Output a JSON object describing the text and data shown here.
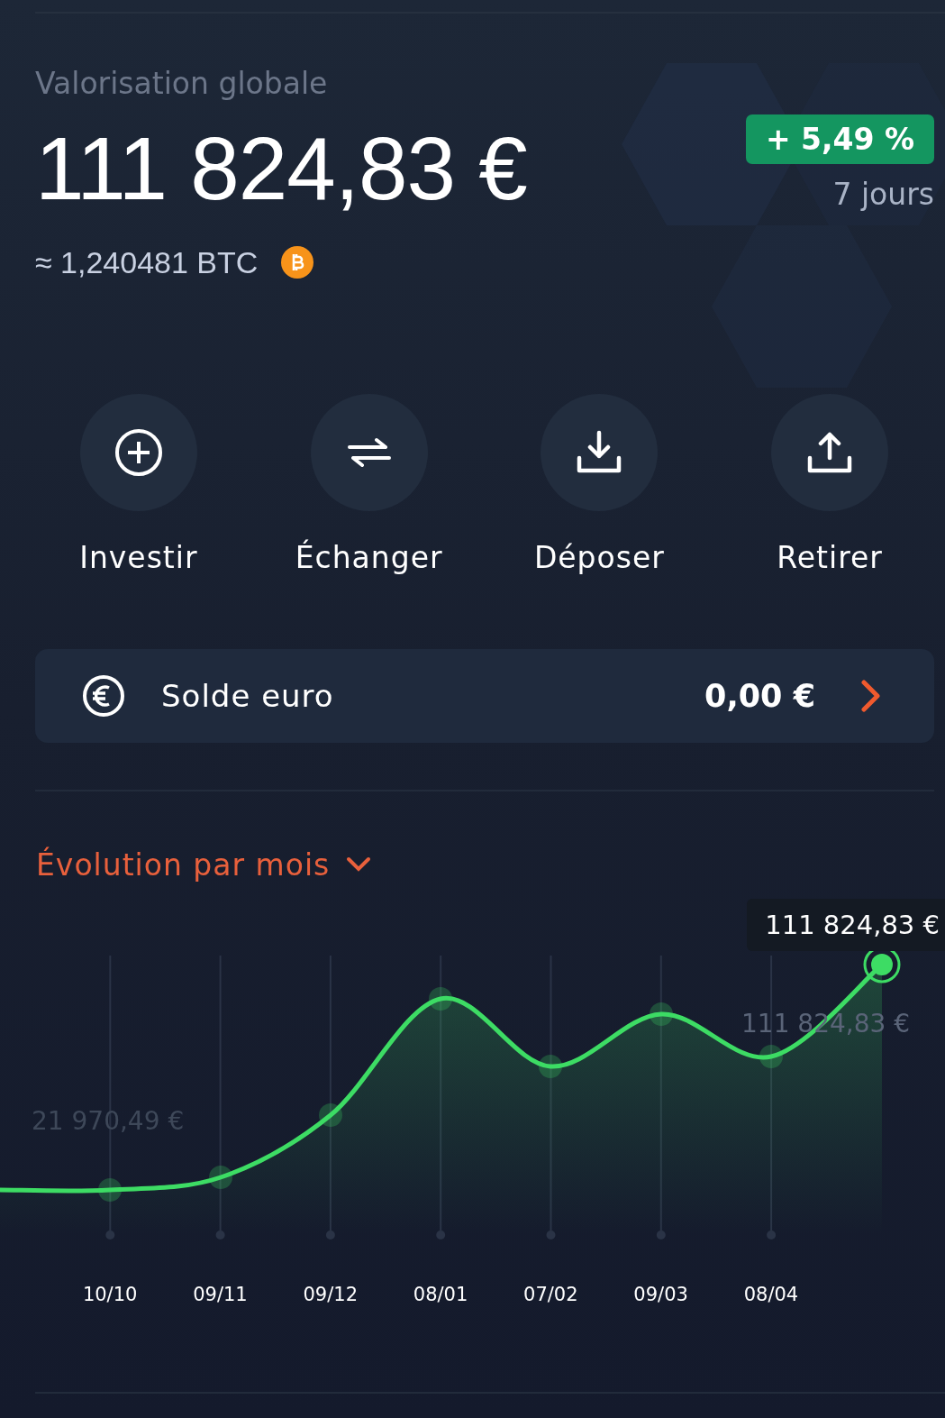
{
  "header": {
    "title": "Valorisation globale",
    "total": "111 824,83 €",
    "btc": "≈ 1,240481 BTC",
    "change": {
      "value": "+ 5,49 %",
      "positive": true
    },
    "period": "7 jours"
  },
  "actions": [
    {
      "kind": "invest",
      "label": "Investir"
    },
    {
      "kind": "exchange",
      "label": "Échanger"
    },
    {
      "kind": "deposit",
      "label": "Déposer"
    },
    {
      "kind": "withdraw",
      "label": "Retirer"
    }
  ],
  "balance": {
    "label": "Solde euro",
    "amount": "0,00 €"
  },
  "chart": {
    "title": "Évolution par mois",
    "tooltip": "111 824,83 €",
    "min_label": "21 970,49 €",
    "max_label": "111 824,83 €",
    "dates": [
      "10/10",
      "09/11",
      "09/12",
      "08/01",
      "07/02",
      "09/03",
      "08/04"
    ]
  }
}
